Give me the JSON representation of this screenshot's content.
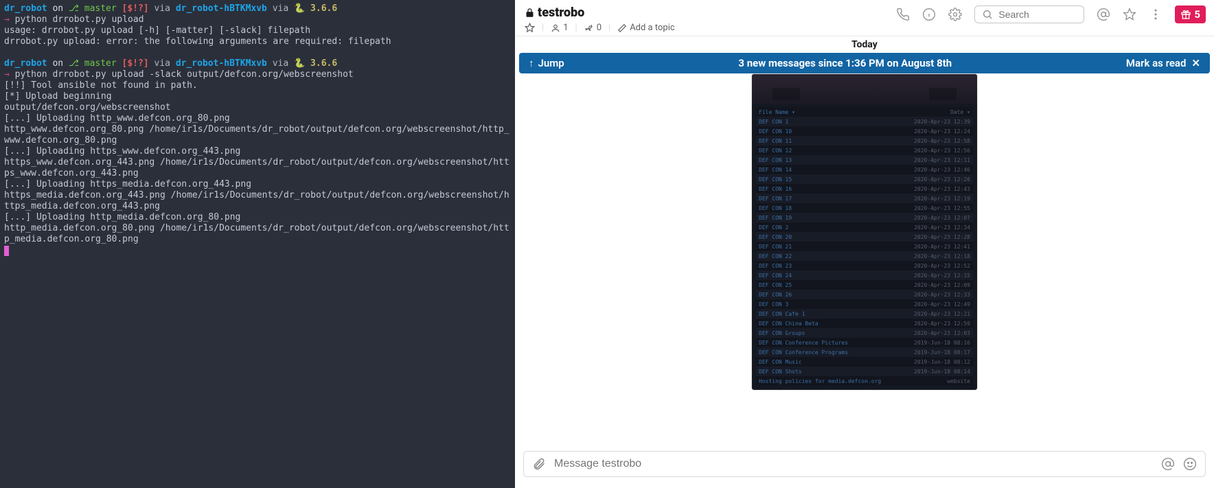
{
  "terminal": {
    "prompt1": {
      "dir": "dr_robot",
      "on": "on",
      "branch_sym": "⎇",
      "branch": "master",
      "flags": "[$!?]",
      "via1": "via",
      "env": "dr_robot-hBTKMxvb",
      "via2": "via",
      "pysym": "🐍",
      "pyver": "3.6.6"
    },
    "cmd1": "python drrobot.py upload",
    "out1a": "usage: drrobot.py upload [-h] [-matter] [-slack] filepath",
    "out1b": "drrobot.py upload: error: the following arguments are required: filepath",
    "cmd2": "python drrobot.py upload -slack output/defcon.org/webscreenshot",
    "out2": {
      "l1": "[!!] Tool ansible not found in path.",
      "l2": "[*] Upload beginning",
      "l3": "output/defcon.org/webscreenshot",
      "l4": "[...] Uploading http_www.defcon.org_80.png",
      "l5": "http_www.defcon.org_80.png /home/ir1s/Documents/dr_robot/output/defcon.org/webscreenshot/http_www.defcon.org_80.png",
      "l6": "[...] Uploading https_www.defcon.org_443.png",
      "l7": "https_www.defcon.org_443.png /home/ir1s/Documents/dr_robot/output/defcon.org/webscreenshot/https_www.defcon.org_443.png",
      "l8": "[...] Uploading https_media.defcon.org_443.png",
      "l9": "https_media.defcon.org_443.png /home/ir1s/Documents/dr_robot/output/defcon.org/webscreenshot/https_media.defcon.org_443.png",
      "l10": "[...] Uploading http_media.defcon.org_80.png",
      "l11": "http_media.defcon.org_80.png /home/ir1s/Documents/dr_robot/output/defcon.org/webscreenshot/http_media.defcon.org_80.png"
    }
  },
  "slack": {
    "channel_name": "testrobo",
    "members": "1",
    "pins": "0",
    "add_topic": "Add a topic",
    "search_placeholder": "Search",
    "gift_count": "5",
    "today_label": "Today",
    "jump_label": "Jump",
    "new_msg_label": "3 new messages since 1:36 PM on August 8th",
    "mark_read": "Mark as read",
    "composer_placeholder": "Message testrobo",
    "attach": {
      "header_left": "File Name",
      "header_right": "Date",
      "rows": [
        {
          "l": "DEF CON 1",
          "r": "2020-Apr-23 12:39"
        },
        {
          "l": "DEF CON 10",
          "r": "2020-Apr-23 12:24"
        },
        {
          "l": "DEF CON 11",
          "r": "2020-Apr-23 12:58"
        },
        {
          "l": "DEF CON 12",
          "r": "2020-Apr-23 12:56"
        },
        {
          "l": "DEF CON 13",
          "r": "2020-Apr-23 12:11"
        },
        {
          "l": "DEF CON 14",
          "r": "2020-Apr-23 12:46"
        },
        {
          "l": "DEF CON 15",
          "r": "2020-Apr-23 12:20"
        },
        {
          "l": "DEF CON 16",
          "r": "2020-Apr-23 12:43"
        },
        {
          "l": "DEF CON 17",
          "r": "2020-Apr-23 12:19"
        },
        {
          "l": "DEF CON 18",
          "r": "2020-Apr-23 12:55"
        },
        {
          "l": "DEF CON 19",
          "r": "2020-Apr-23 12:07"
        },
        {
          "l": "DEF CON 2",
          "r": "2020-Apr-23 12:34"
        },
        {
          "l": "DEF CON 20",
          "r": "2020-Apr-23 12:28"
        },
        {
          "l": "DEF CON 21",
          "r": "2020-Apr-23 12:41"
        },
        {
          "l": "DEF CON 22",
          "r": "2020-Apr-23 12:18"
        },
        {
          "l": "DEF CON 23",
          "r": "2020-Apr-23 12:52"
        },
        {
          "l": "DEF CON 24",
          "r": "2020-Apr-23 12:15"
        },
        {
          "l": "DEF CON 25",
          "r": "2020-Apr-23 12:09"
        },
        {
          "l": "DEF CON 26",
          "r": "2020-Apr-23 12:33"
        },
        {
          "l": "DEF CON 3",
          "r": "2020-Apr-23 12:49"
        },
        {
          "l": "DEF CON Cafe 1",
          "r": "2020-Apr-23 12:21"
        },
        {
          "l": "DEF CON China Beta",
          "r": "2020-Apr-23 12:59"
        },
        {
          "l": "DEF CON Groups",
          "r": "2020-Apr-23 12:03"
        },
        {
          "l": "DEF CON Conference Pictures",
          "r": "2019-Jun-18 08:16"
        },
        {
          "l": "DEF CON Conference Programs",
          "r": "2019-Jun-18 08:17"
        },
        {
          "l": "DEF CON Music",
          "r": "2019-Jun-18 08:12"
        },
        {
          "l": "DEF CON Shots",
          "r": "2019-Jun-18 08:14"
        },
        {
          "l": "Hosting policies for media.defcon.org",
          "r": "website"
        }
      ]
    }
  }
}
